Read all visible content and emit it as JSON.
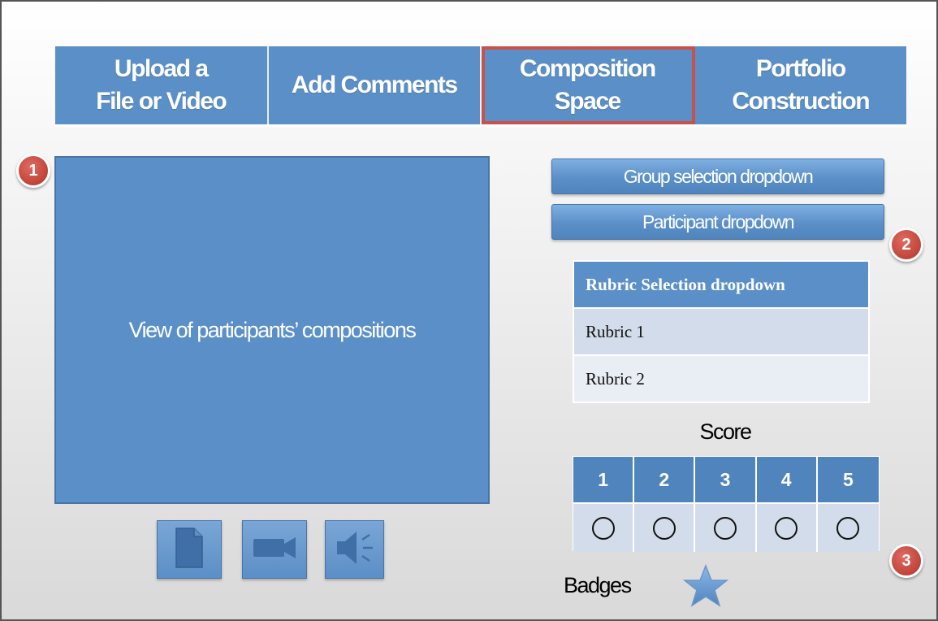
{
  "tabs": [
    {
      "label": "Upload  a\nFile or Video",
      "active": false
    },
    {
      "label": "Add Comments",
      "active": false
    },
    {
      "label": "Composition\nSpace",
      "active": true
    },
    {
      "label": "Portfolio\nConstruction",
      "active": false
    }
  ],
  "markers": {
    "m1": "1",
    "m2": "2",
    "m3": "3"
  },
  "viewer": {
    "label": "View of participants’ compositions"
  },
  "media_buttons": [
    {
      "icon": "document-icon"
    },
    {
      "icon": "video-camera-icon"
    },
    {
      "icon": "speaker-icon"
    }
  ],
  "dropdowns": {
    "group": "Group selection dropdown",
    "participant": "Participant dropdown"
  },
  "rubric": {
    "header": "Rubric Selection dropdown",
    "items": [
      "Rubric 1",
      "Rubric 2"
    ]
  },
  "score": {
    "title": "Score",
    "values": [
      "1",
      "2",
      "3",
      "4",
      "5"
    ]
  },
  "badges": {
    "label": "Badges",
    "icon": "star-icon"
  },
  "colors": {
    "accent_blue": "#5b8fc7",
    "active_outline": "#c8524a",
    "marker_red": "#c0443a",
    "rubric_row": "#d3dcea"
  }
}
